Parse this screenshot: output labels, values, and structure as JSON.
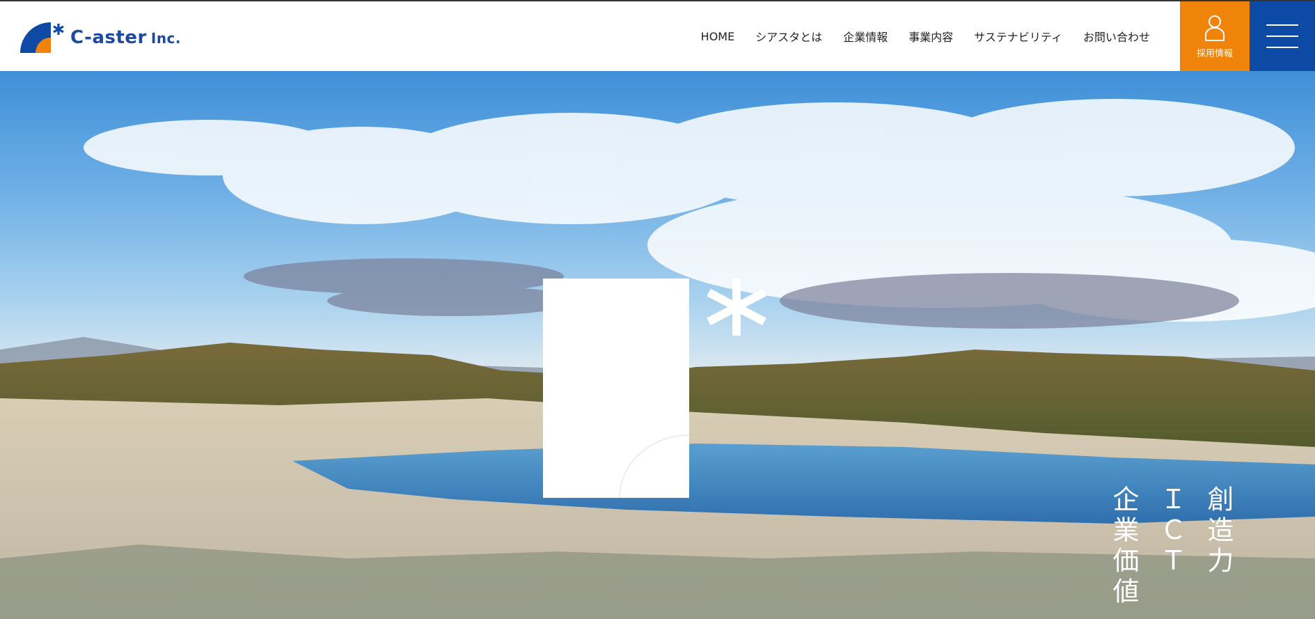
{
  "brand": {
    "name": "C-aster",
    "suffix": "Inc.",
    "primary_color": "#0d4aa6",
    "accent_color": "#f0830a"
  },
  "nav": {
    "items": [
      {
        "label": "HOME"
      },
      {
        "label": "シアスタとは"
      },
      {
        "label": "企業情報"
      },
      {
        "label": "事業内容"
      },
      {
        "label": "サステナビリティ"
      },
      {
        "label": "お問い合わせ"
      }
    ]
  },
  "recruit": {
    "label": "採用情報",
    "icon": "person-icon"
  },
  "menu": {
    "icon": "hamburger-icon"
  },
  "hero": {
    "tagline": [
      "創造力",
      "ＩＣＴ",
      "企業価値"
    ]
  }
}
